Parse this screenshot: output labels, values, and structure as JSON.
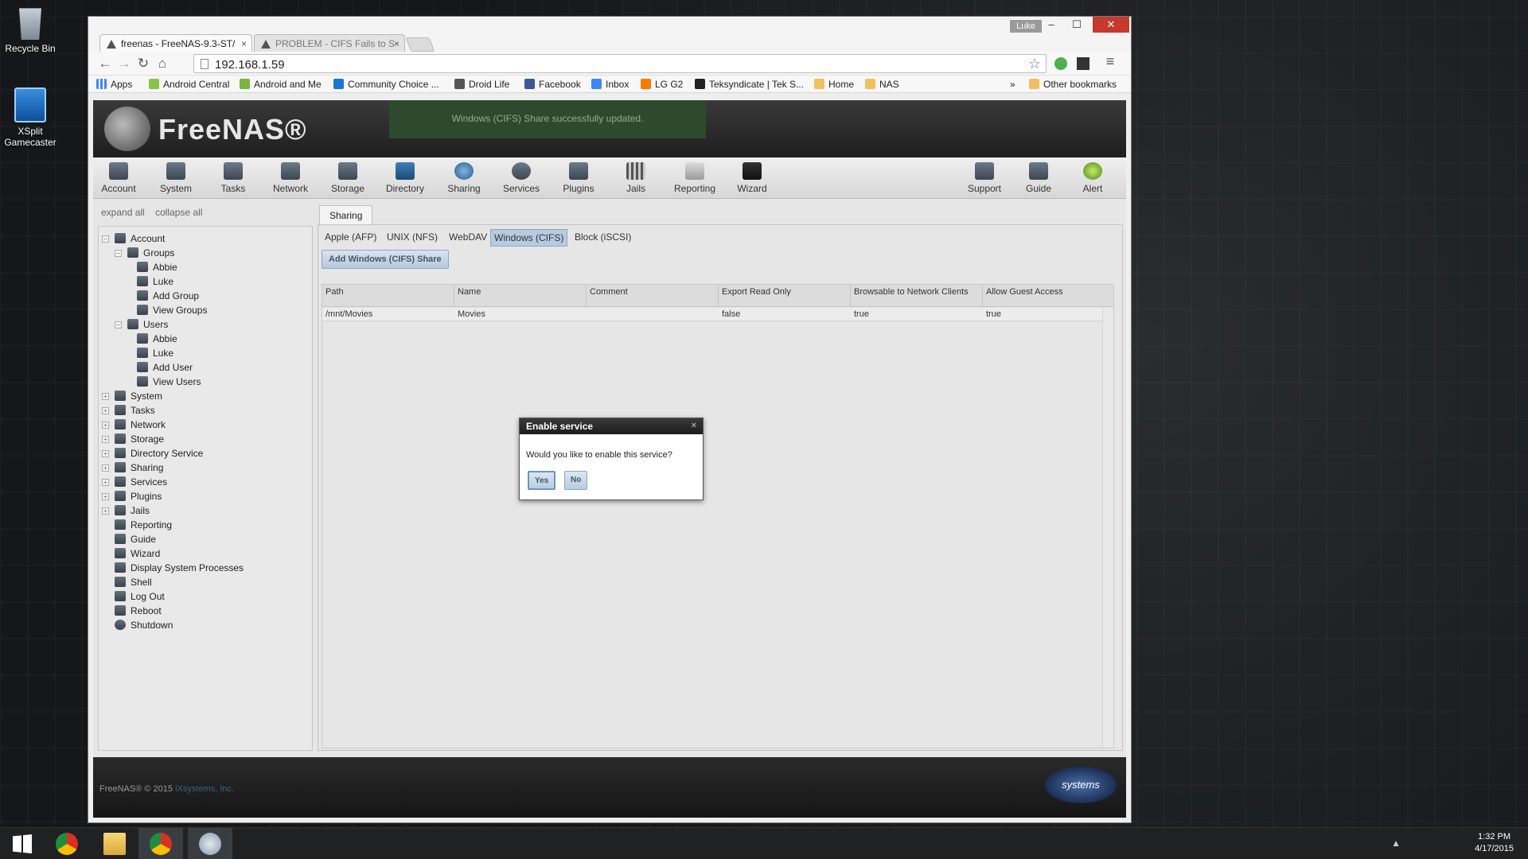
{
  "desktop": {
    "icons": [
      {
        "label": "Recycle Bin"
      },
      {
        "label": "XSplit\nGamecaster"
      }
    ]
  },
  "browser": {
    "tabs": [
      {
        "title": "freenas - FreeNAS-9.3-ST/",
        "close": "×"
      },
      {
        "title": "PROBLEM - CIFS Fails to S",
        "close": "×"
      }
    ],
    "user_badge": "Luke",
    "window_controls": {
      "min": "–",
      "max": "☐",
      "close": "✕"
    },
    "url": "192.168.1.59",
    "nav": {
      "back": "←",
      "forward": "→",
      "reload": "↻",
      "home": "⌂",
      "star": "☆",
      "menu": "≡"
    },
    "bookmarks": [
      "Apps",
      "Android Central",
      "Android and Me",
      "Community Choice ...",
      "Droid Life",
      "Facebook",
      "Inbox",
      "LG G2",
      "Teksyndicate | Tek S...",
      "Home",
      "NAS"
    ],
    "bookmarks_more": "»",
    "other_bookmarks": "Other bookmarks"
  },
  "freenas": {
    "logo_text": "FreeNAS®",
    "notice": "Windows (CIFS) Share successfully updated.",
    "top_menu": [
      "Account",
      "System",
      "Tasks",
      "Network",
      "Storage",
      "Directory",
      "Sharing",
      "Services",
      "Plugins",
      "Jails",
      "Reporting",
      "Wizard",
      "Support",
      "Guide",
      "Alert"
    ],
    "sidebar": {
      "expand_all": "expand all",
      "collapse_all": "collapse all",
      "tree": {
        "account": "Account",
        "groups": "Groups",
        "group_items": [
          "Abbie",
          "Luke",
          "Add Group",
          "View Groups"
        ],
        "users": "Users",
        "user_items": [
          "Abbie",
          "Luke",
          "Add User",
          "View Users"
        ],
        "top_level": [
          "System",
          "Tasks",
          "Network",
          "Storage",
          "Directory Service",
          "Sharing",
          "Services",
          "Plugins",
          "Jails",
          "Reporting",
          "Guide",
          "Wizard",
          "Display System Processes",
          "Shell",
          "Log Out",
          "Reboot",
          "Shutdown"
        ]
      }
    },
    "content": {
      "tab": "Sharing",
      "subtabs": [
        "Apple (AFP)",
        "UNIX (NFS)",
        "WebDAV",
        "Windows (CIFS)",
        "Block (iSCSI)"
      ],
      "active_subtab": "Windows (CIFS)",
      "add_button": "Add Windows (CIFS) Share",
      "columns": [
        "Path",
        "Name",
        "Comment",
        "Export Read Only",
        "Browsable to Network Clients",
        "Allow Guest Access"
      ],
      "rows": [
        [
          "/mnt/Movies",
          "Movies",
          "",
          "false",
          "true",
          "true"
        ]
      ]
    },
    "footer": {
      "copyright": "FreeNAS® © 2015",
      "company": "iXsystems, Inc.",
      "logo": "systems"
    },
    "dialog": {
      "title": "Enable service",
      "close": "×",
      "message": "Would you like to enable this service?",
      "yes": "Yes",
      "no": "No"
    }
  },
  "taskbar": {
    "tray_arrow": "▲",
    "time": "1:32 PM",
    "date": "4/17/2015"
  }
}
